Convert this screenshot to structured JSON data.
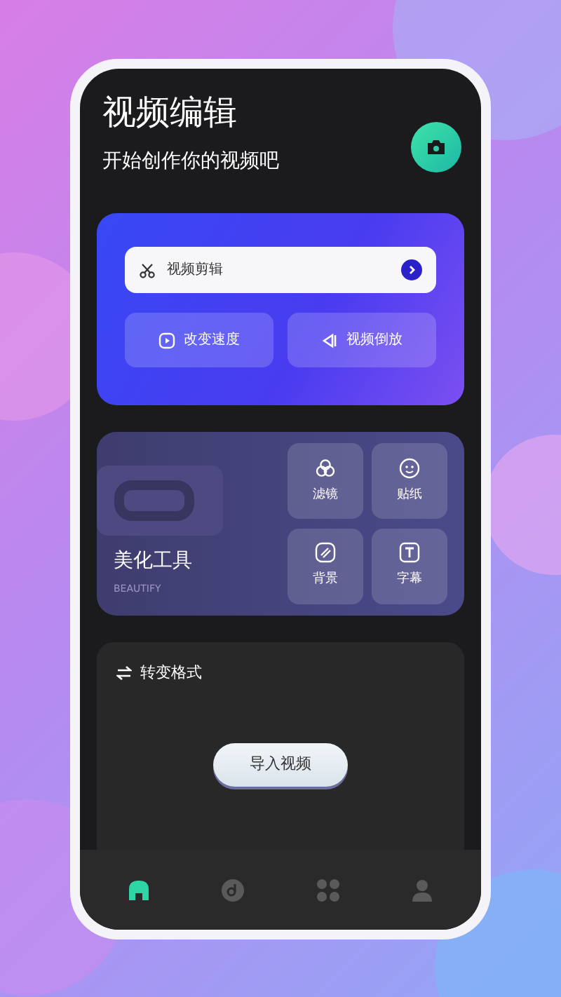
{
  "header": {
    "title": "视频编辑",
    "subtitle": "开始创作你的视频吧"
  },
  "edit_card": {
    "main_action": "视频剪辑",
    "actions": [
      {
        "label": "改变速度",
        "kind": "speed"
      },
      {
        "label": "视频倒放",
        "kind": "reverse"
      }
    ]
  },
  "beautify_card": {
    "title": "美化工具",
    "subtitle": "BEAUTIFY",
    "tools": [
      {
        "label": "滤镜",
        "kind": "filter"
      },
      {
        "label": "贴纸",
        "kind": "sticker"
      },
      {
        "label": "背景",
        "kind": "background"
      },
      {
        "label": "字幕",
        "kind": "subtitle"
      }
    ]
  },
  "convert_card": {
    "title": "转变格式",
    "button": "导入视频"
  },
  "nav": [
    {
      "kind": "home",
      "selected": true
    },
    {
      "kind": "music",
      "selected": false
    },
    {
      "kind": "apps",
      "selected": false
    },
    {
      "kind": "profile",
      "selected": false
    }
  ]
}
